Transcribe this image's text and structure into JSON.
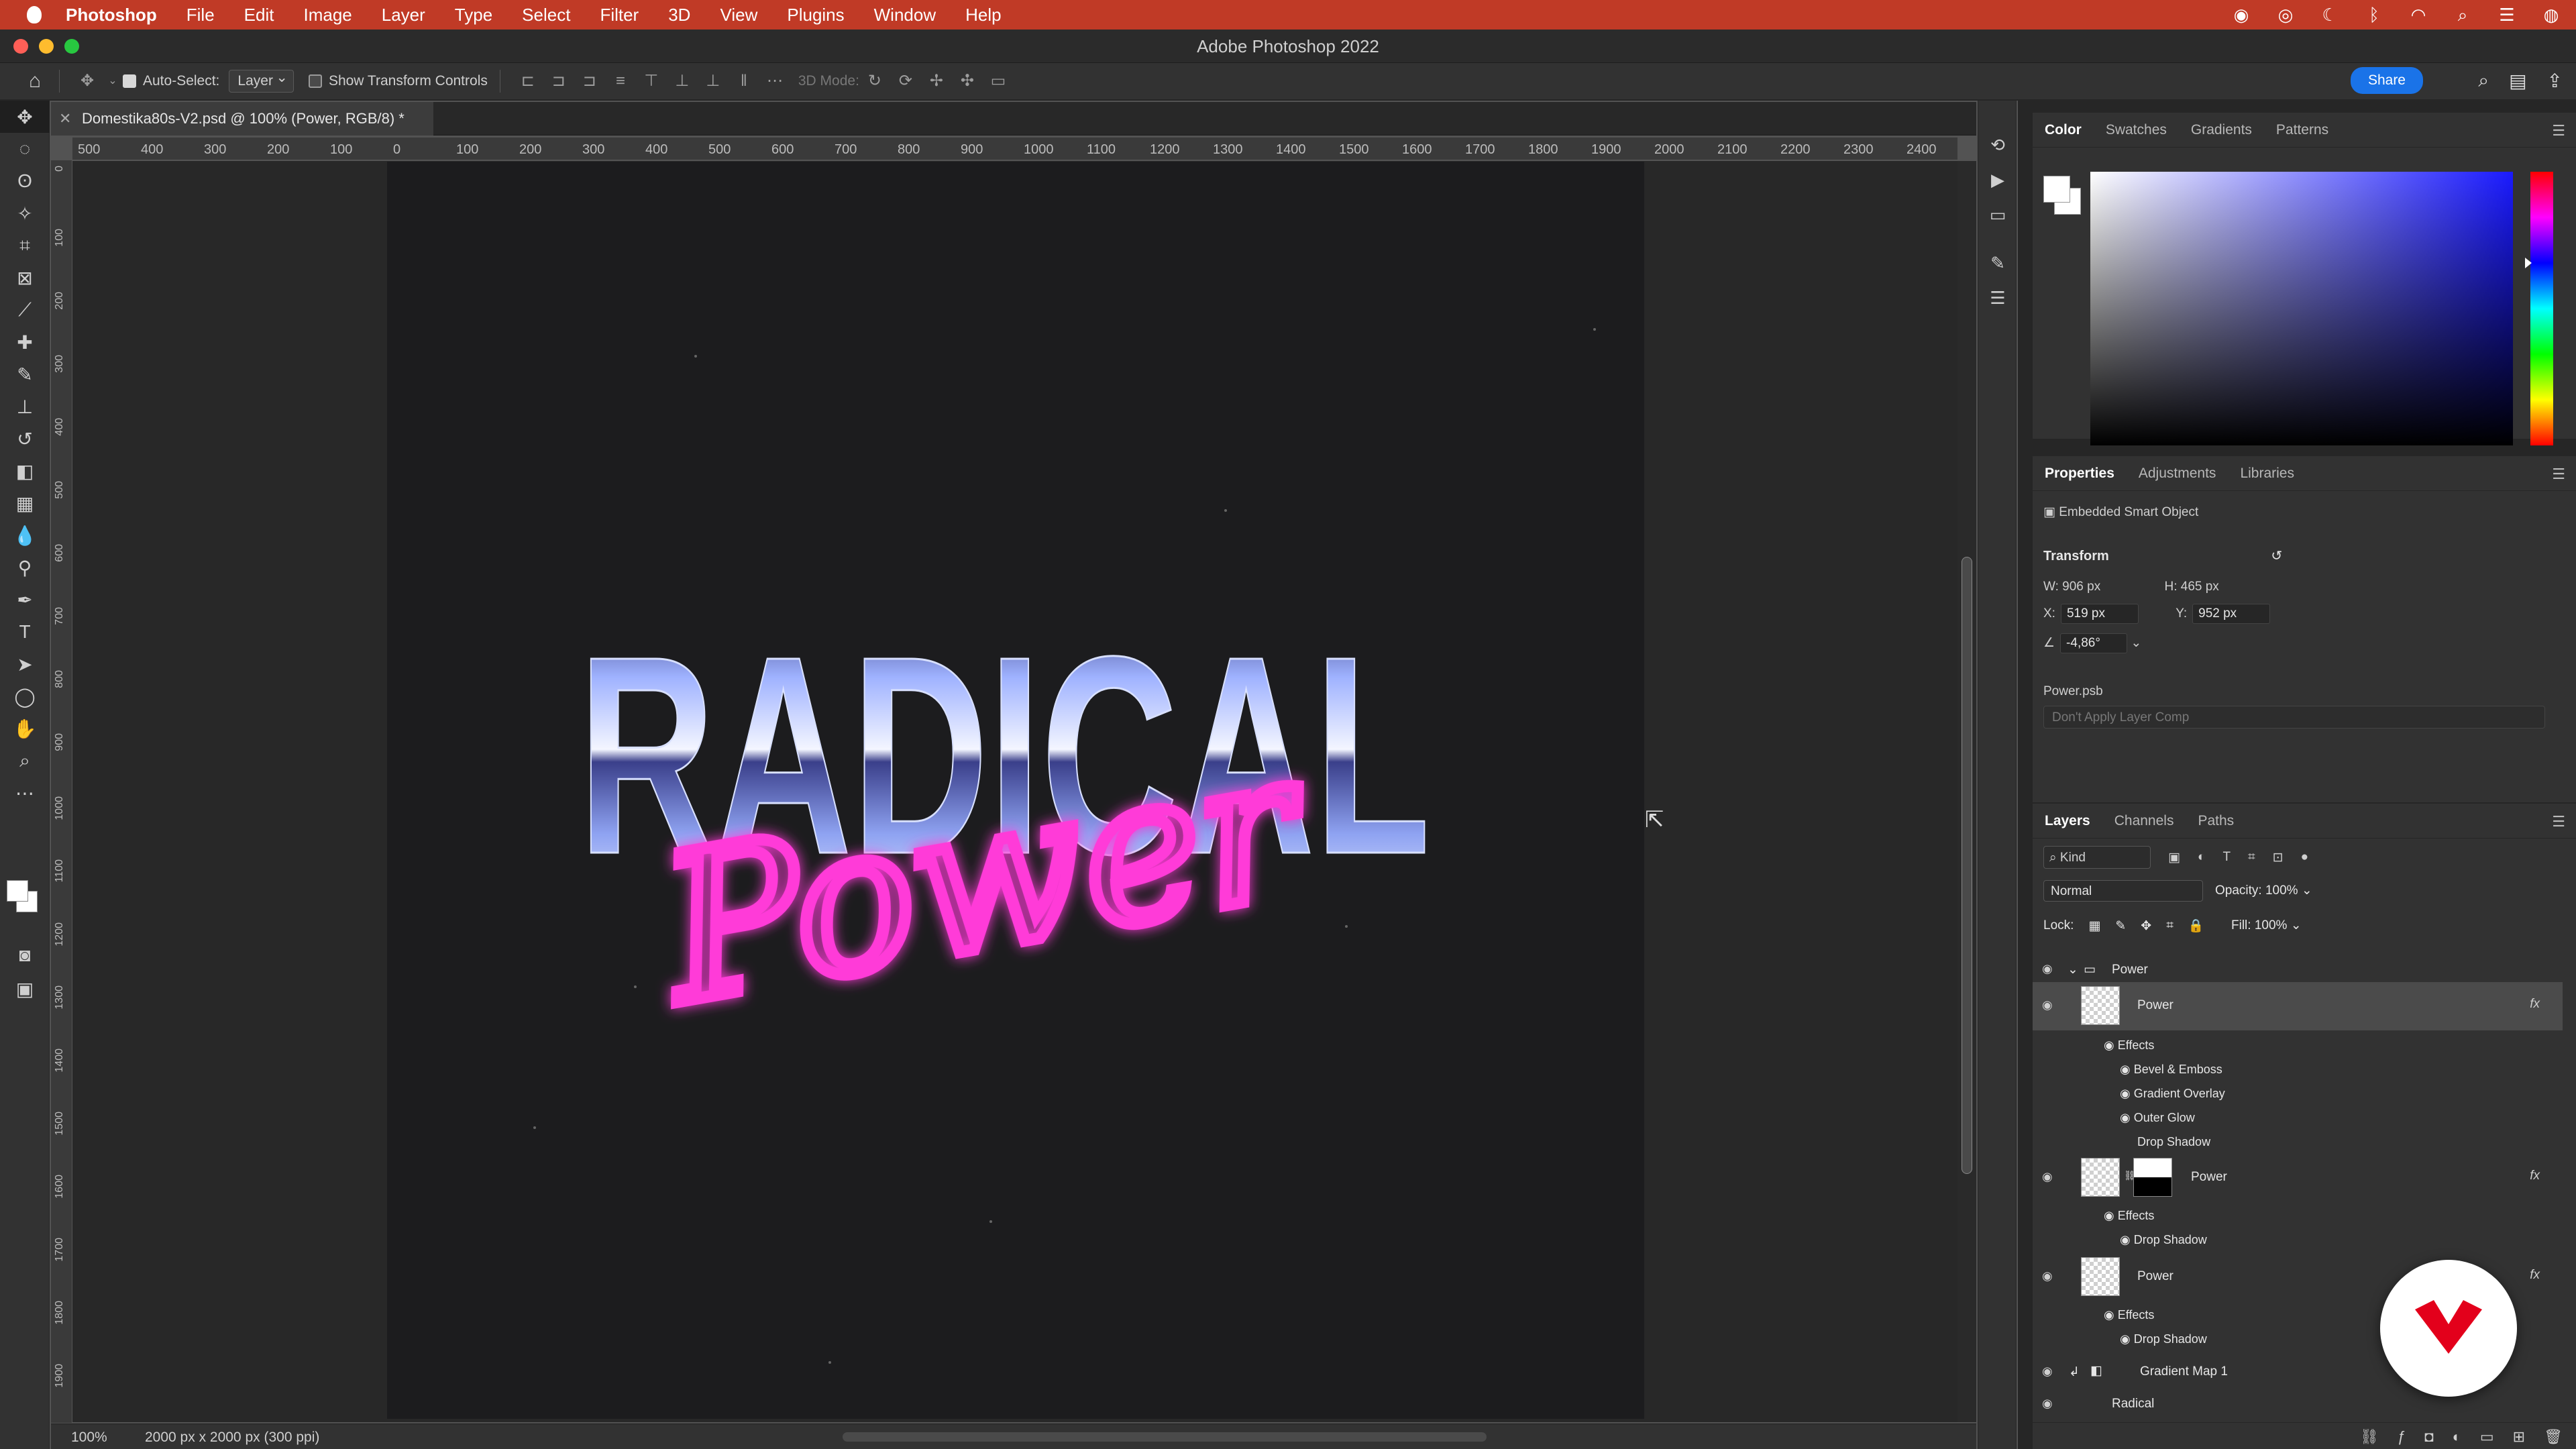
{
  "menubar": {
    "app": "Photoshop",
    "items": [
      "File",
      "Edit",
      "Image",
      "Layer",
      "Type",
      "Select",
      "Filter",
      "3D",
      "View",
      "Plugins",
      "Window",
      "Help"
    ]
  },
  "window": {
    "title": "Adobe Photoshop 2022"
  },
  "options": {
    "auto_select_label": "Auto-Select:",
    "auto_select_value": "Layer",
    "transform_label": "Show Transform Controls",
    "mode_label": "3D Mode:",
    "share": "Share"
  },
  "document": {
    "tab_title": "Domestika80s-V2.psd @ 100% (Power, RGB/8) *",
    "zoom": "100%",
    "dimensions": "2000 px x 2000 px (300 ppi)"
  },
  "hruler": [
    "500",
    "400",
    "300",
    "200",
    "100",
    "0",
    "100",
    "200",
    "300",
    "400",
    "500",
    "600",
    "700",
    "800",
    "900",
    "1000",
    "1100",
    "1200",
    "1300",
    "1400",
    "1500",
    "1600",
    "1700",
    "1800",
    "1900",
    "2000",
    "2100",
    "2200",
    "2300",
    "2400"
  ],
  "vruler": [
    "0",
    "1 0 0",
    "2 0 0",
    "3 0 0",
    "4 0 0",
    "5 0 0",
    "6 0 0",
    "7 0 0",
    "8 0 0",
    "9 0 0",
    "1 0 0 0",
    "1 1 0 0",
    "1 2 0 0",
    "1 3 0 0",
    "1 4 0 0",
    "1 5 0 0",
    "1 6 0 0",
    "1 7 0 0",
    "1 8 0 0",
    "1 9 0 0"
  ],
  "artwork": {
    "headline": "RADICAL",
    "script": "Power"
  },
  "color_panel": {
    "tabs": [
      "Color",
      "Swatches",
      "Gradients",
      "Patterns"
    ],
    "active": "Color"
  },
  "properties": {
    "tabs": [
      "Properties",
      "Adjustments",
      "Libraries"
    ],
    "type": "Embedded Smart Object",
    "transform_label": "Transform",
    "w_label": "W:",
    "w": "906 px",
    "h_label": "H:",
    "h": "465 px",
    "x_label": "X:",
    "x": "519 px",
    "y_label": "Y:",
    "y": "952 px",
    "angle": "-4,86°",
    "file": "Power.psb",
    "layer_comp": "Don't Apply Layer Comp"
  },
  "layers": {
    "tabs": [
      "Layers",
      "Channels",
      "Paths"
    ],
    "filter": "Kind",
    "blend_mode": "Normal",
    "opacity_label": "Opacity:",
    "opacity": "100%",
    "lock_label": "Lock:",
    "fill_label": "Fill:",
    "fill": "100%",
    "group": "Power",
    "layer1": "Power",
    "effects_label": "Effects",
    "effects1": [
      "Bevel & Emboss",
      "Gradient Overlay",
      "Outer Glow",
      "Drop Shadow"
    ],
    "layer2": "Power",
    "effects2": [
      "Drop Shadow"
    ],
    "layer3": "Power",
    "effects3": [
      "Drop Shadow"
    ],
    "layer4": "Gradient Map 1",
    "layer5": "Radical",
    "fx": "fx"
  },
  "colors": {
    "menubar": "#c03a26",
    "share": "#1a73e8",
    "neon": "#ff3ad8",
    "chrome": "#9fb2ff"
  }
}
